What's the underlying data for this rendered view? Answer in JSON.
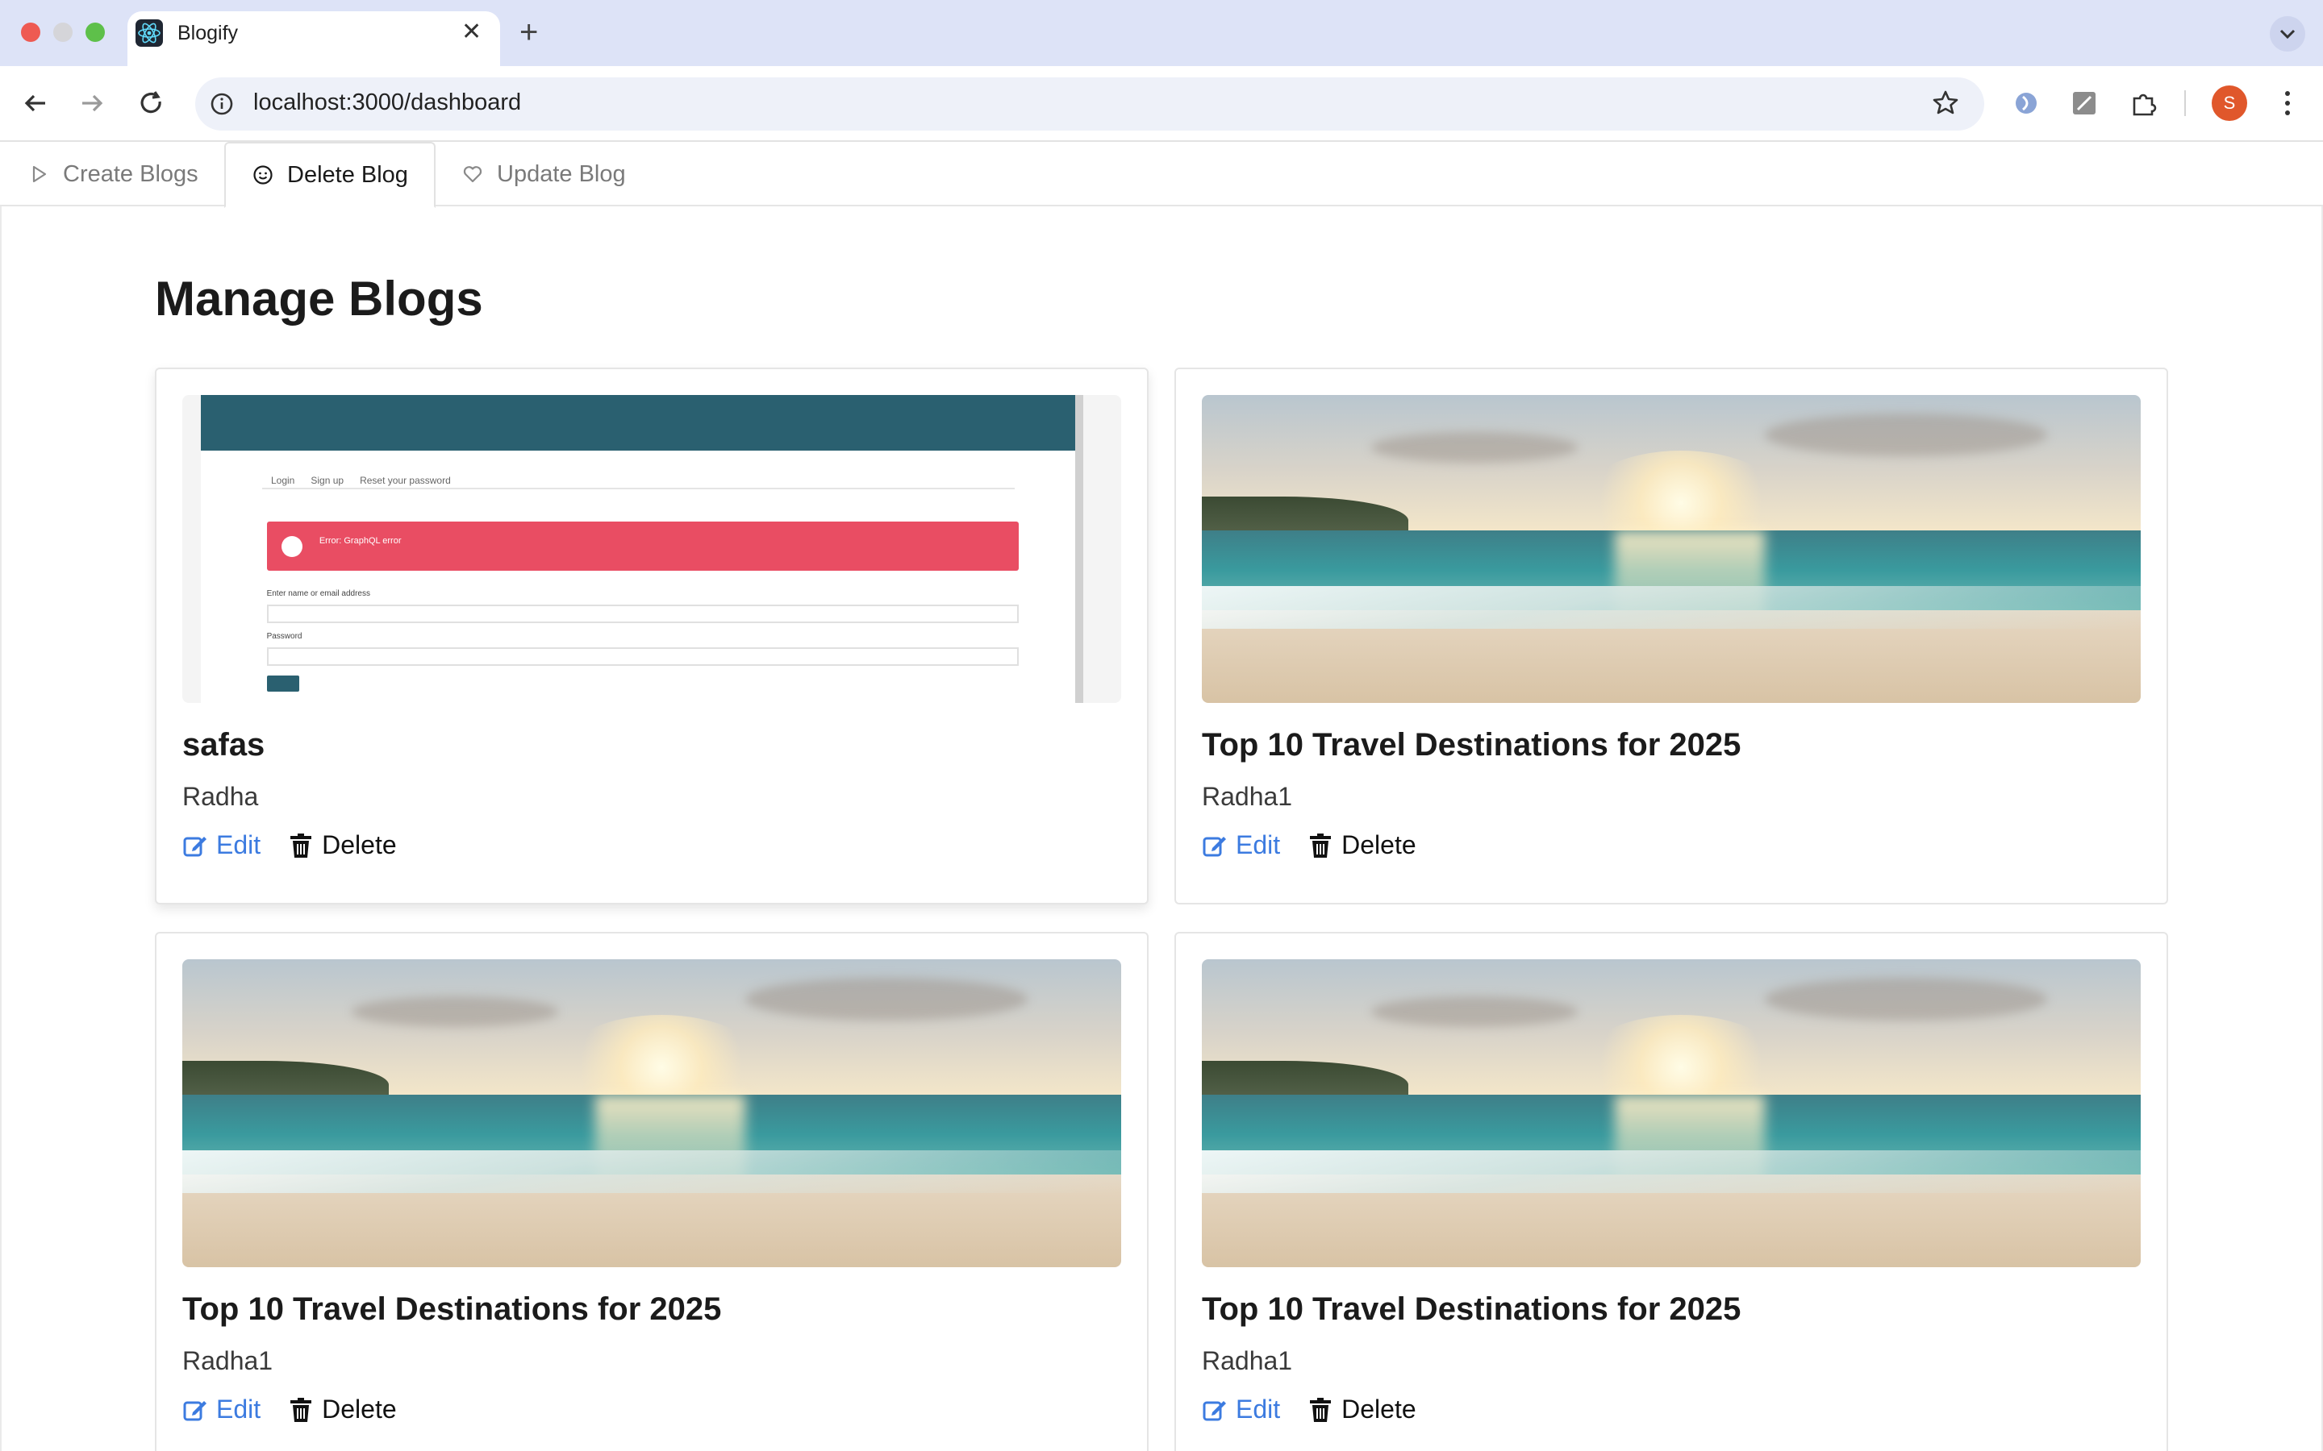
{
  "browser": {
    "tab_title": "Blogify",
    "url": "localhost:3000/dashboard",
    "profile_initial": "S"
  },
  "app_tabs": [
    {
      "label": "Create Blogs",
      "icon": "play-icon",
      "active": false
    },
    {
      "label": "Delete Blog",
      "icon": "smile-icon",
      "active": true
    },
    {
      "label": "Update Blog",
      "icon": "heart-icon",
      "active": false
    }
  ],
  "page": {
    "title": "Manage Blogs"
  },
  "blogs": [
    {
      "title": "safas",
      "author": "Radha",
      "image": "screenshot-thumbnail",
      "edit_label": "Edit",
      "delete_label": "Delete"
    },
    {
      "title": "Top 10 Travel Destinations for 2025",
      "author": "Radha1",
      "image": "beach-photo",
      "edit_label": "Edit",
      "delete_label": "Delete"
    },
    {
      "title": "Top 10 Travel Destinations for 2025",
      "author": "Radha1",
      "image": "beach-photo",
      "edit_label": "Edit",
      "delete_label": "Delete"
    },
    {
      "title": "Top 10 Travel Destinations for 2025",
      "author": "Radha1",
      "image": "beach-photo",
      "edit_label": "Edit",
      "delete_label": "Delete"
    }
  ],
  "colors": {
    "accent": "#3c7be0",
    "tabstrip": "#dde3f7",
    "avatar": "#e0572b"
  }
}
